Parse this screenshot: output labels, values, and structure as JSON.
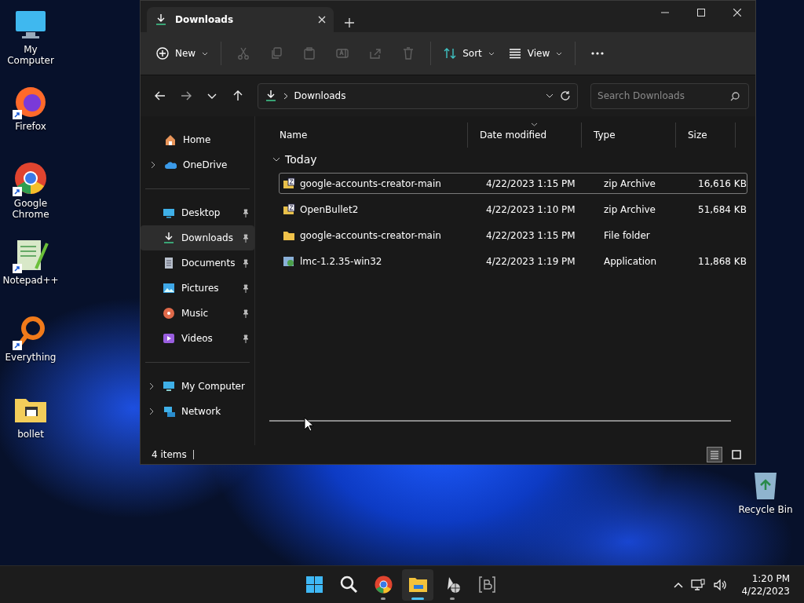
{
  "desktop_icons": [
    {
      "label": "My Computer",
      "kind": "computer"
    },
    {
      "label": "Firefox",
      "kind": "firefox",
      "shortcut": true
    },
    {
      "label": "Google Chrome",
      "kind": "chrome",
      "shortcut": true
    },
    {
      "label": "Notepad++",
      "kind": "notepad",
      "shortcut": true
    },
    {
      "label": "Everything",
      "kind": "search",
      "shortcut": true
    },
    {
      "label": "bollet",
      "kind": "folder",
      "shortcut": false
    }
  ],
  "recycle_bin": {
    "label": "Recycle Bin"
  },
  "window": {
    "tabs": [
      {
        "title": "Downloads",
        "selected": true
      }
    ],
    "toolbar": [
      {
        "kind": "new",
        "label": "New",
        "disabled": false
      },
      {
        "kind": "separator"
      },
      {
        "kind": "cut",
        "disabled": true
      },
      {
        "kind": "copy",
        "disabled": true
      },
      {
        "kind": "paste",
        "disabled": true
      },
      {
        "kind": "rename",
        "disabled": true
      },
      {
        "kind": "share",
        "disabled": true
      },
      {
        "kind": "delete",
        "disabled": true
      },
      {
        "kind": "separator"
      },
      {
        "kind": "sort",
        "label": "Sort",
        "disabled": false
      },
      {
        "kind": "view",
        "label": "View",
        "disabled": false
      },
      {
        "kind": "separator"
      },
      {
        "kind": "more",
        "disabled": false
      }
    ],
    "address": {
      "path": [
        "Downloads"
      ]
    },
    "search": {
      "placeholder": "Search Downloads"
    },
    "nav_sections": [
      [
        {
          "label": "Home",
          "kind": "home",
          "expandable": false,
          "pinned": false,
          "selected": false
        },
        {
          "label": "OneDrive",
          "kind": "cloud",
          "expandable": true,
          "pinned": false,
          "selected": false
        }
      ],
      [
        {
          "label": "Desktop",
          "kind": "desktop",
          "expandable": false,
          "pinned": true,
          "selected": false
        },
        {
          "label": "Downloads",
          "kind": "download",
          "expandable": false,
          "pinned": true,
          "selected": true
        },
        {
          "label": "Documents",
          "kind": "documents",
          "expandable": false,
          "pinned": true,
          "selected": false
        },
        {
          "label": "Pictures",
          "kind": "pictures",
          "expandable": false,
          "pinned": true,
          "selected": false
        },
        {
          "label": "Music",
          "kind": "music",
          "expandable": false,
          "pinned": true,
          "selected": false
        },
        {
          "label": "Videos",
          "kind": "videos",
          "expandable": false,
          "pinned": true,
          "selected": false
        }
      ],
      [
        {
          "label": "My Computer",
          "kind": "computer",
          "expandable": true,
          "pinned": false,
          "selected": false
        },
        {
          "label": "Network",
          "kind": "network",
          "expandable": true,
          "pinned": false,
          "selected": false
        }
      ]
    ],
    "columns": [
      {
        "label": "Name",
        "sorted": false
      },
      {
        "label": "Date modified",
        "sorted": true
      },
      {
        "label": "Type",
        "sorted": false
      },
      {
        "label": "Size",
        "sorted": false
      }
    ],
    "groups": [
      {
        "label": "Today",
        "expanded": true,
        "rows": [
          {
            "name": "google-accounts-creator-main",
            "kind": "zip",
            "date": "4/22/2023 1:15 PM",
            "type": "zip Archive",
            "size": "16,616 KB",
            "selected": true
          },
          {
            "name": "OpenBullet2",
            "kind": "zip",
            "date": "4/22/2023 1:10 PM",
            "type": "zip Archive",
            "size": "51,684 KB",
            "selected": false
          },
          {
            "name": "google-accounts-creator-main",
            "kind": "folder",
            "date": "4/22/2023 1:15 PM",
            "type": "File folder",
            "selected": false
          },
          {
            "name": "lmc-1.2.35-win32",
            "kind": "app",
            "date": "4/22/2023 1:19 PM",
            "type": "Application",
            "size": "11,868 KB",
            "selected": false
          }
        ]
      }
    ],
    "status": {
      "count": "4 items",
      "views": [
        {
          "kind": "details",
          "selected": true
        },
        {
          "kind": "tiles",
          "selected": false
        }
      ]
    }
  },
  "taskbar": {
    "apps": [
      {
        "kind": "start",
        "running": false,
        "active": false
      },
      {
        "kind": "search",
        "running": false,
        "active": false
      },
      {
        "kind": "chrome",
        "running": true,
        "active": false
      },
      {
        "kind": "explorer",
        "running": true,
        "active": true
      },
      {
        "kind": "globeapp",
        "running": true,
        "active": false
      },
      {
        "kind": "bracket",
        "running": false,
        "active": false
      }
    ],
    "time": "1:20 PM",
    "date": "4/22/2023"
  }
}
